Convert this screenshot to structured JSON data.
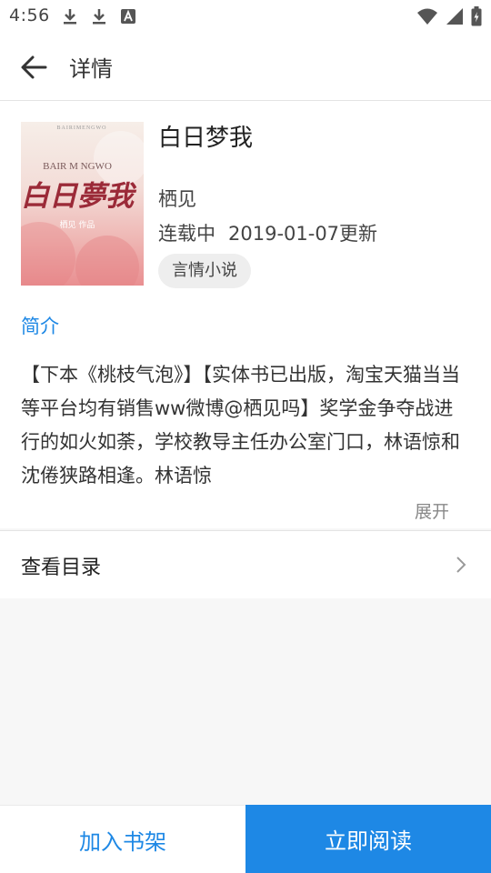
{
  "status_bar": {
    "time": "4:56",
    "icons_left": [
      "download-icon",
      "download-icon",
      "a-app-icon"
    ],
    "icons_right": [
      "wifi-icon",
      "signal-icon",
      "battery-icon"
    ]
  },
  "header": {
    "title": "详情",
    "back_icon": "arrow-left-icon"
  },
  "book": {
    "title": "白日梦我",
    "author": "栖见",
    "serial_status": "连载中",
    "update_text": "2019-01-07更新",
    "genre": "言情小说",
    "cover": {
      "top_text": "BAIRIMENGWO",
      "roman_title": "BAIR M NGWO",
      "big_title": "白日夢我",
      "subtitle": "栖见 作品"
    }
  },
  "intro": {
    "label": "简介",
    "text": "【下本《桃枝气泡》】【实体书已出版，淘宝天猫当当等平台均有销售ww微博@栖见吗】奖学金争夺战进行的如火如荼，学校教导主任办公室门口，林语惊和沈倦狭路相逢。林语惊",
    "expand_label": "展开"
  },
  "catalog": {
    "label": "查看目录",
    "chevron_icon": "chevron-right-icon"
  },
  "bottom_bar": {
    "add_to_shelf": "加入书架",
    "read_now": "立即阅读"
  },
  "colors": {
    "accent": "#1e88e5",
    "background": "#f7f7f7"
  }
}
